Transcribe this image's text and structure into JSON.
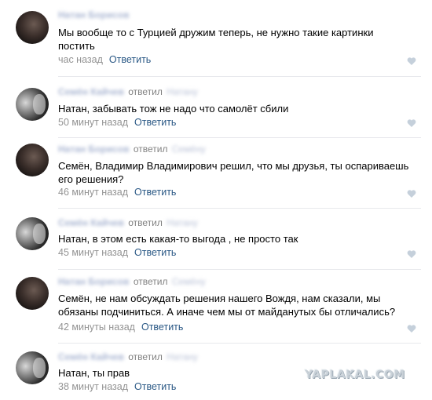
{
  "ui": {
    "reply_word": "ответил",
    "reply_button": "Ответить"
  },
  "colors": {
    "text": "#000000",
    "link": "#2a5885",
    "meta": "#939393",
    "divider": "#e7e8ec",
    "heart": "#c5d0db"
  },
  "comments": [
    {
      "author": "Натан Борисов",
      "reply_to": "",
      "text": "Мы вообще то с Турцией дружим теперь, не нужно такие картинки постить",
      "time": "час назад",
      "avatar_icon": "dark-portrait-avatar"
    },
    {
      "author": "Семён Кайчев",
      "reply_to": "Натану",
      "text": "Натан, забывать тож не надо что самолёт сбили",
      "time": "50 минут назад",
      "avatar_icon": "bw-photo-avatar"
    },
    {
      "author": "Натан Борисов",
      "reply_to": "Семёну",
      "text": "Семён, Владимир Владимирович решил, что мы друзья, ты оспариваешь его решения?",
      "time": "46 минут назад",
      "avatar_icon": "dark-portrait-avatar"
    },
    {
      "author": "Семён Кайчев",
      "reply_to": "Натану",
      "text": "Натан, в этом есть какая-то выгода , не просто так",
      "time": "45 минут назад",
      "avatar_icon": "bw-photo-avatar"
    },
    {
      "author": "Натан Борисов",
      "reply_to": "Семёну",
      "text": "Семён, не нам обсуждать решения нашего Вождя, нам сказали, мы обязаны подчиниться. А иначе чем мы от майданутых бы отличались?",
      "time": "42 минуты назад",
      "avatar_icon": "dark-portrait-avatar"
    },
    {
      "author": "Семён Кайчев",
      "reply_to": "Натану",
      "text": "Натан, ты прав",
      "time": "38 минут назад",
      "avatar_icon": "bw-photo-avatar"
    }
  ],
  "watermark": "YAPLAKAL.COM"
}
